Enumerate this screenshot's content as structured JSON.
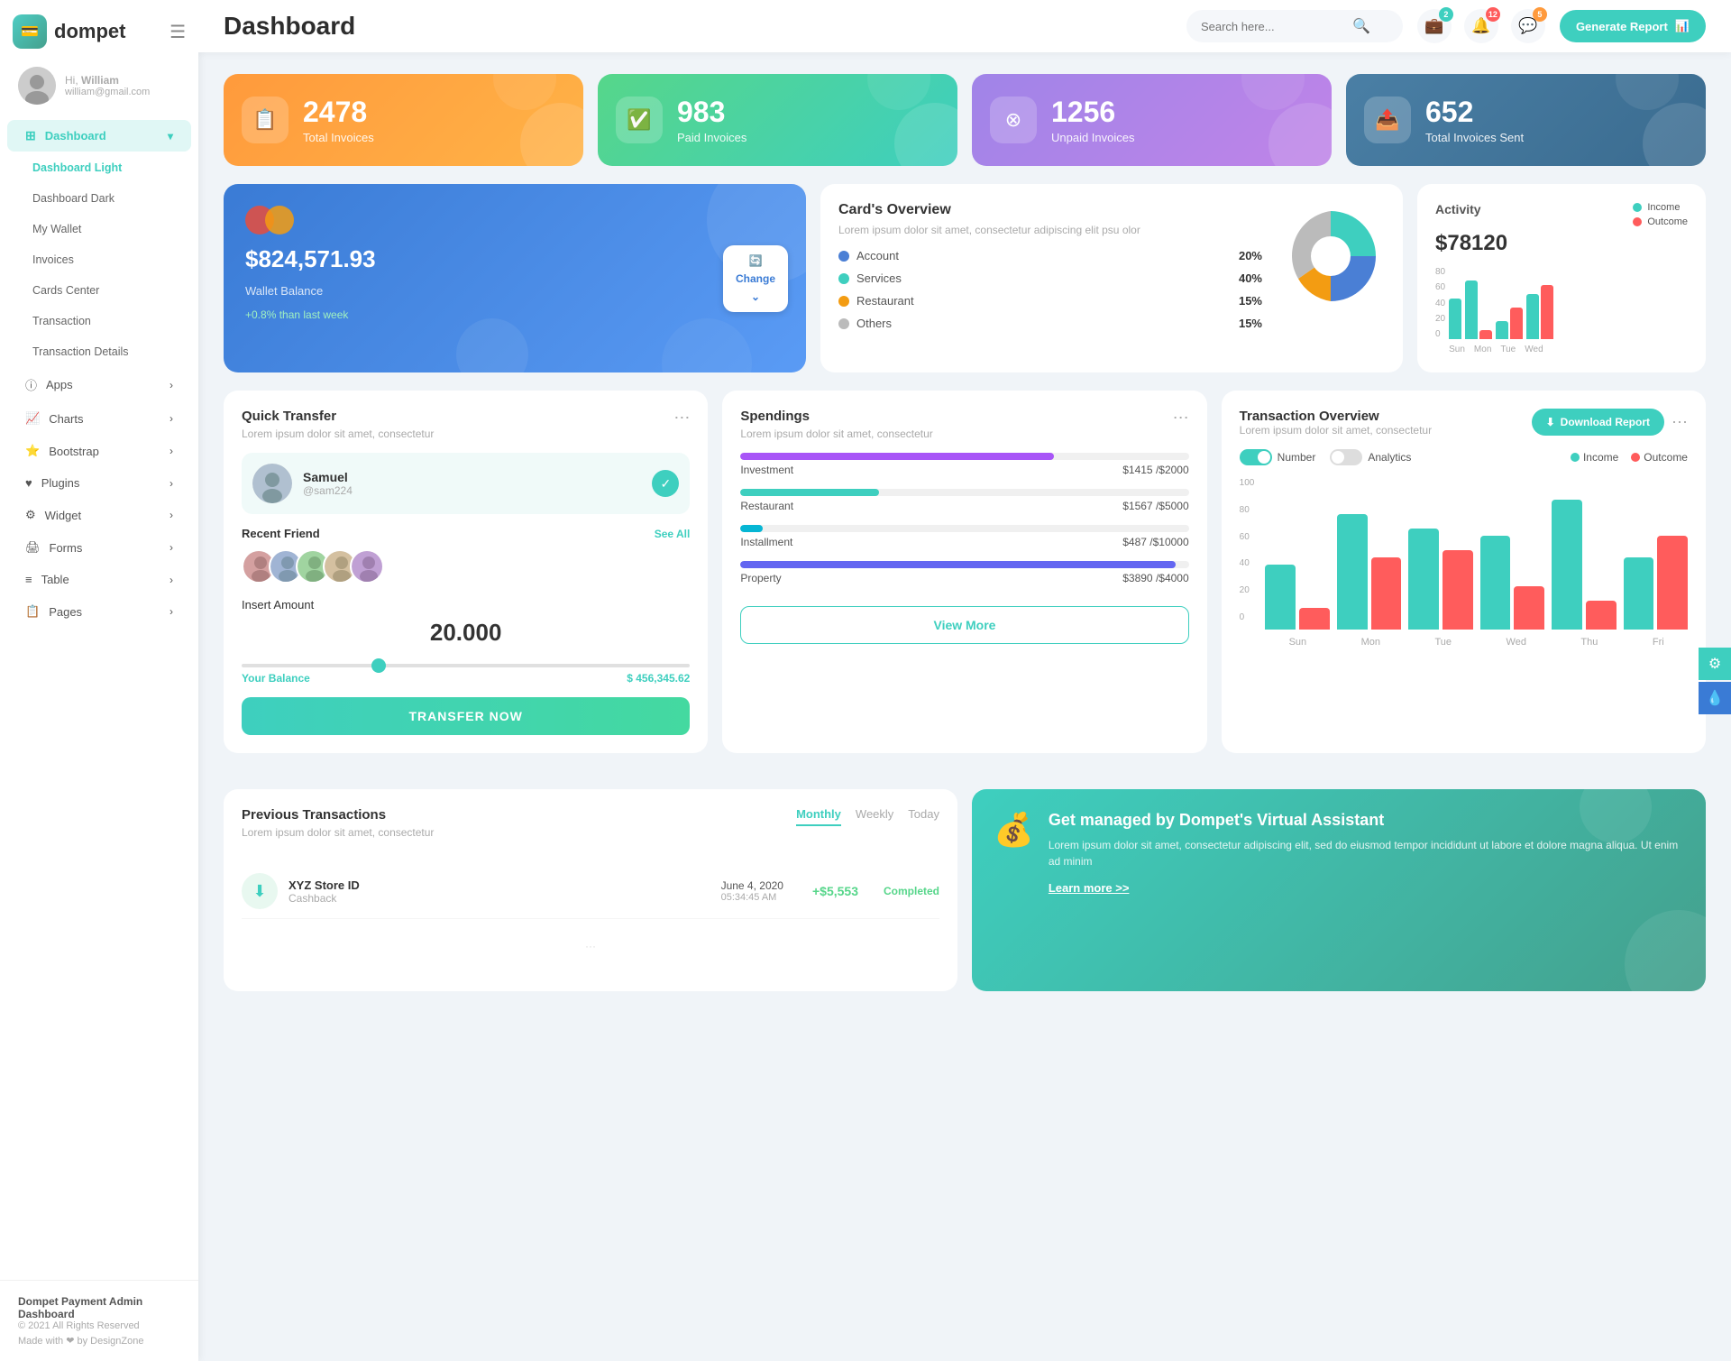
{
  "app": {
    "name": "dompet",
    "logo_icon": "💳"
  },
  "header": {
    "title": "Dashboard",
    "search_placeholder": "Search here...",
    "generate_btn": "Generate Report",
    "badges": {
      "wallet": "2",
      "bell": "12",
      "chat": "5"
    }
  },
  "user": {
    "hi": "Hi,",
    "name": "William",
    "email": "william@gmail.com",
    "avatar": "👤"
  },
  "sidebar": {
    "nav": [
      {
        "id": "dashboard",
        "label": "Dashboard",
        "icon": "⊞",
        "active": true,
        "arrow": true
      },
      {
        "id": "dashboard-light",
        "label": "Dashboard Light",
        "sub": true,
        "active": true
      },
      {
        "id": "dashboard-dark",
        "label": "Dashboard Dark",
        "sub": true
      },
      {
        "id": "my-wallet",
        "label": "My Wallet",
        "sub": true
      },
      {
        "id": "invoices",
        "label": "Invoices",
        "sub": true
      },
      {
        "id": "cards-center",
        "label": "Cards Center",
        "sub": true
      },
      {
        "id": "transaction",
        "label": "Transaction",
        "sub": true
      },
      {
        "id": "transaction-details",
        "label": "Transaction Details",
        "sub": true
      },
      {
        "id": "apps",
        "label": "Apps",
        "icon": "ⓘ",
        "arrow": true
      },
      {
        "id": "charts",
        "label": "Charts",
        "icon": "📈",
        "arrow": true
      },
      {
        "id": "bootstrap",
        "label": "Bootstrap",
        "icon": "⭐",
        "arrow": true
      },
      {
        "id": "plugins",
        "label": "Plugins",
        "icon": "♥",
        "arrow": true
      },
      {
        "id": "widget",
        "label": "Widget",
        "icon": "⚙",
        "arrow": true
      },
      {
        "id": "forms",
        "label": "Forms",
        "icon": "🖨",
        "arrow": true
      },
      {
        "id": "table",
        "label": "Table",
        "icon": "≡",
        "arrow": true
      },
      {
        "id": "pages",
        "label": "Pages",
        "icon": "📋",
        "arrow": true
      }
    ],
    "footer_brand": "Dompet Payment Admin Dashboard",
    "footer_year": "© 2021 All Rights Reserved",
    "footer_made": "Made with ❤ by DesignZone"
  },
  "stat_cards": [
    {
      "id": "total-invoices",
      "number": "2478",
      "label": "Total Invoices",
      "icon": "📋",
      "color": "orange"
    },
    {
      "id": "paid-invoices",
      "number": "983",
      "label": "Paid Invoices",
      "icon": "✅",
      "color": "green"
    },
    {
      "id": "unpaid-invoices",
      "number": "1256",
      "label": "Unpaid Invoices",
      "icon": "⊗",
      "color": "purple"
    },
    {
      "id": "total-sent",
      "number": "652",
      "label": "Total Invoices Sent",
      "icon": "📤",
      "color": "blue-dark"
    }
  ],
  "wallet": {
    "balance": "$824,571.93",
    "label": "Wallet Balance",
    "change": "+0.8% than last week",
    "change_btn": "Change"
  },
  "cards_overview": {
    "title": "Card's Overview",
    "subtitle": "Lorem ipsum dolor sit amet, consectetur adipiscing elit psu olor",
    "items": [
      {
        "label": "Account",
        "pct": "20%",
        "color": "#4a7fd5"
      },
      {
        "label": "Services",
        "pct": "40%",
        "color": "#3ecfbf"
      },
      {
        "label": "Restaurant",
        "pct": "15%",
        "color": "#f39c12"
      },
      {
        "label": "Others",
        "pct": "15%",
        "color": "#bbb"
      }
    ]
  },
  "activity": {
    "title": "Activity",
    "amount": "$78120",
    "income_label": "Income",
    "outcome_label": "Outcome",
    "income_color": "#3ecfbf",
    "outcome_color": "#ff5c5c",
    "days": [
      "Sun",
      "Mon",
      "Tue",
      "Wed"
    ],
    "bars": [
      {
        "income": 45,
        "outcome": 0
      },
      {
        "income": 65,
        "outcome": 10
      },
      {
        "income": 20,
        "outcome": 35
      },
      {
        "income": 50,
        "outcome": 60
      }
    ]
  },
  "quick_transfer": {
    "title": "Quick Transfer",
    "subtitle": "Lorem ipsum dolor sit amet, consectetur",
    "selected_friend": {
      "name": "Samuel",
      "handle": "@sam224",
      "avatar": "👨"
    },
    "recent_label": "Recent Friend",
    "see_all": "See All",
    "friends": [
      "👩",
      "👨‍🦱",
      "👦",
      "👩‍🦰",
      "👱"
    ],
    "insert_amount_label": "Insert Amount",
    "amount": "20.000",
    "balance_label": "Your Balance",
    "balance_value": "$ 456,345.62",
    "transfer_btn": "TRANSFER NOW"
  },
  "spendings": {
    "title": "Spendings",
    "subtitle": "Lorem ipsum dolor sit amet, consectetur",
    "items": [
      {
        "label": "Investment",
        "value": "$1415",
        "total": "$2000",
        "pct": 70,
        "color": "#a855f7"
      },
      {
        "label": "Restaurant",
        "value": "$1567",
        "total": "$5000",
        "pct": 31,
        "color": "#3ecfbf"
      },
      {
        "label": "Installment",
        "value": "$487",
        "total": "$10000",
        "pct": 5,
        "color": "#06b6d4"
      },
      {
        "label": "Property",
        "value": "$3890",
        "total": "$4000",
        "pct": 97,
        "color": "#6366f1"
      }
    ],
    "view_more": "View More"
  },
  "tx_overview": {
    "title": "Transaction Overview",
    "subtitle": "Lorem ipsum dolor sit amet, consectetur",
    "download_btn": "Download Report",
    "toggle_number": "Number",
    "toggle_analytics": "Analytics",
    "income_label": "Income",
    "outcome_label": "Outcome",
    "income_color": "#3ecfbf",
    "outcome_color": "#ff5c5c",
    "days": [
      "Sun",
      "Mon",
      "Tue",
      "Wed",
      "Thu",
      "Fri"
    ],
    "bars": [
      {
        "income": 45,
        "outcome": 15
      },
      {
        "income": 80,
        "outcome": 50
      },
      {
        "income": 70,
        "outcome": 55
      },
      {
        "income": 65,
        "outcome": 30
      },
      {
        "income": 90,
        "outcome": 20
      },
      {
        "income": 50,
        "outcome": 65
      }
    ],
    "y_labels": [
      "0",
      "20",
      "40",
      "60",
      "80",
      "100"
    ]
  },
  "prev_transactions": {
    "title": "Previous Transactions",
    "subtitle": "Lorem ipsum dolor sit amet, consectetur",
    "tabs": [
      "Monthly",
      "Weekly",
      "Today"
    ],
    "active_tab": "Monthly",
    "items": [
      {
        "name": "XYZ Store ID",
        "type": "Cashback",
        "date": "June 4, 2020",
        "time": "05:34:45 AM",
        "amount": "+$5,553",
        "status": "Completed",
        "icon": "⬇",
        "icon_bg": "#e8f8f0",
        "icon_color": "#3ecfbf"
      }
    ]
  },
  "va_banner": {
    "title": "Get managed by Dompet's Virtual Assistant",
    "subtitle": "Lorem ipsum dolor sit amet, consectetur adipiscing elit, sed do eiusmod tempor incididunt ut labore et dolore magna aliqua. Ut enim ad minim",
    "link": "Learn more >>"
  }
}
